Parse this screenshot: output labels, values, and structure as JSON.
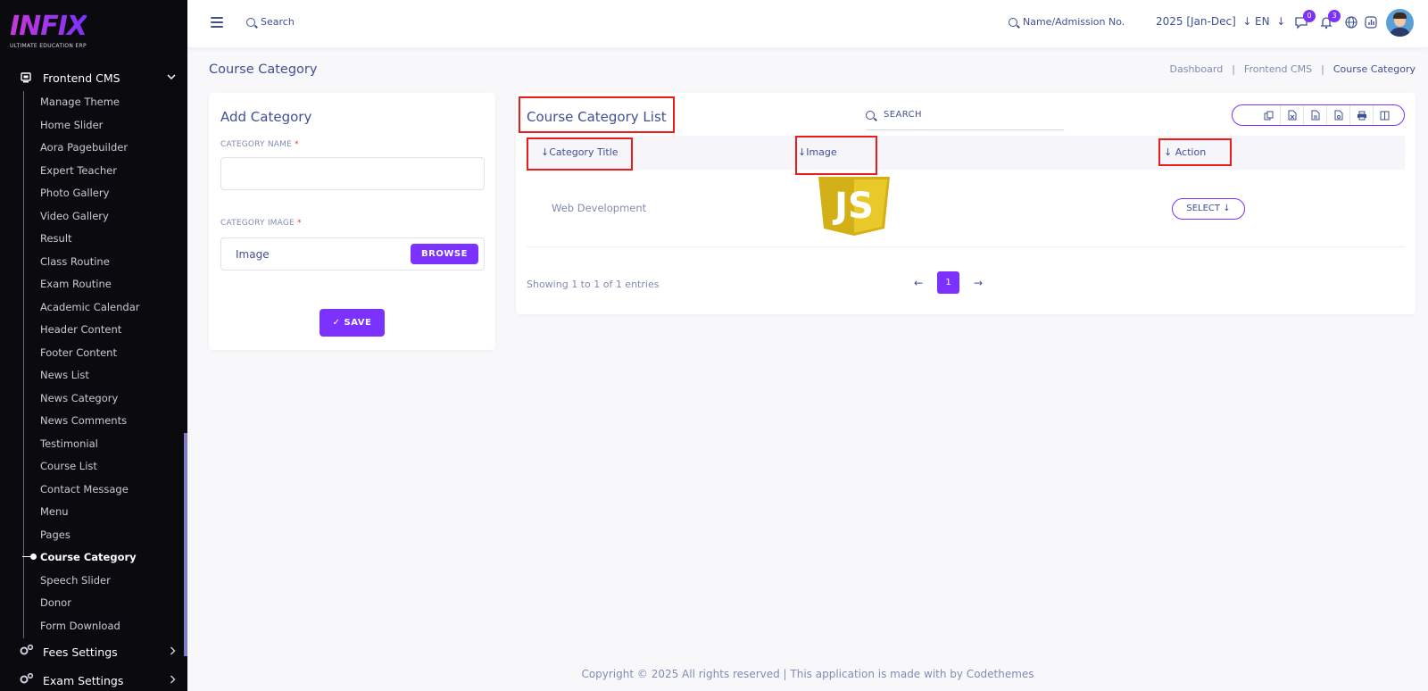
{
  "sidebar": {
    "logo_text": "INFIX",
    "logo_subtitle": "ULTIMATE EDUCATION ERP",
    "active_section": "Frontend CMS",
    "items": [
      {
        "label": "Manage Theme"
      },
      {
        "label": "Home Slider"
      },
      {
        "label": "Aora Pagebuilder"
      },
      {
        "label": "Expert Teacher"
      },
      {
        "label": "Photo Gallery"
      },
      {
        "label": "Video Gallery"
      },
      {
        "label": "Result"
      },
      {
        "label": "Class Routine"
      },
      {
        "label": "Exam Routine"
      },
      {
        "label": "Academic Calendar"
      },
      {
        "label": "Header Content"
      },
      {
        "label": "Footer Content"
      },
      {
        "label": "News List"
      },
      {
        "label": "News Category"
      },
      {
        "label": "News Comments"
      },
      {
        "label": "Testimonial"
      },
      {
        "label": "Course List"
      },
      {
        "label": "Contact Message"
      },
      {
        "label": "Menu"
      },
      {
        "label": "Pages"
      },
      {
        "label": "Course Category",
        "active": true
      },
      {
        "label": "Speech Slider"
      },
      {
        "label": "Donor"
      },
      {
        "label": "Form Download"
      }
    ],
    "sections": [
      {
        "label": "Fees Settings"
      },
      {
        "label": "Exam Settings"
      }
    ]
  },
  "header": {
    "search_label": "Search",
    "admission_search": "Name/Admission No.",
    "year": "2025 [Jan-Dec]",
    "language": "EN",
    "messages_count": "0",
    "notifications_count": "3"
  },
  "page": {
    "title": "Course Category",
    "breadcrumb": [
      "Dashboard",
      "Frontend CMS",
      "Course Category"
    ]
  },
  "add_form": {
    "title": "Add Category",
    "name_label": "CATEGORY NAME",
    "image_label": "CATEGORY IMAGE",
    "required_mark": "*",
    "image_placeholder": "Image",
    "browse_label": "BROWSE",
    "save_label": "SAVE"
  },
  "list": {
    "title": "Course Category List",
    "search_placeholder": "SEARCH",
    "columns": [
      "Category Title",
      "Image",
      "Action"
    ],
    "rows": [
      {
        "title": "Web Development",
        "image_text": "JS",
        "action": "SELECT"
      }
    ],
    "showing": "Showing 1 to 1 of 1 entries",
    "current_page": "1"
  },
  "footer": {
    "text": "Copyright © 2025 All rights reserved | This application is made with by Codethemes"
  },
  "colors": {
    "accent": "#7c32ff",
    "text": "#415094",
    "muted": "#828bb2",
    "sidebar_bg": "#0b0b0f",
    "highlight": "#ea1c1c"
  }
}
